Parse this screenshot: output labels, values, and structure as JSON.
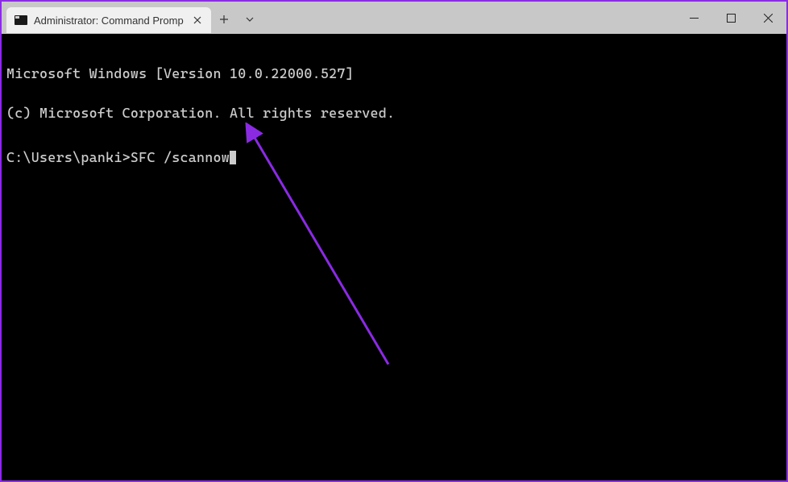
{
  "window": {
    "tab_title": "Administrator: Command Promp",
    "controls": {
      "new_tab": "+",
      "dropdown": "chevron-down"
    }
  },
  "terminal": {
    "line1": "Microsoft Windows [Version 10.0.22000.527]",
    "line2": "(c) Microsoft Corporation. All rights reserved.",
    "prompt": "C:\\Users\\panki>",
    "command": "SFC /scannow"
  },
  "annotation": {
    "color": "#8a2be2",
    "type": "arrow"
  }
}
